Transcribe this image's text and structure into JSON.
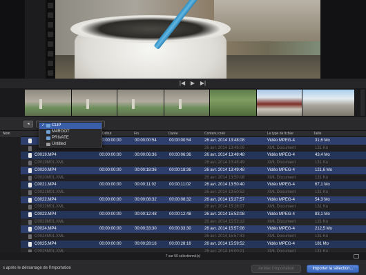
{
  "toolbar": {
    "back_glyph": "◂",
    "location_options": [
      {
        "label": "CLIP",
        "selected": true,
        "icon": "folder-icon"
      },
      {
        "label": "M4ROOT",
        "selected": false,
        "icon": "folder-icon"
      },
      {
        "label": "PRIVATE",
        "selected": false,
        "icon": "folder-icon"
      },
      {
        "label": "Untitled",
        "selected": false,
        "icon": "disk-icon"
      }
    ],
    "check_glyph": "✓"
  },
  "transport": {
    "prev": "|◀",
    "play": "▶",
    "next": "▶|"
  },
  "table": {
    "columns": [
      "Nom",
      "Début",
      "Fin",
      "Durée",
      "Contenu créé",
      "Le type de fichier",
      "Taille"
    ],
    "rows": [
      {
        "name": "",
        "start": "00:00:00:00",
        "end": "00:00:00:54",
        "duration": "00:00:00:54",
        "created": "26 avr. 2014 13:48:08",
        "type": "Vidéo MPEG-4",
        "size": "31,6 Mo",
        "kind": "mp4"
      },
      {
        "name": "",
        "start": "",
        "end": "",
        "duration": "",
        "created": "26 avr. 2014 13:48:09",
        "type": "XML Document",
        "size": "131 Ko",
        "kind": "xml"
      },
      {
        "name": "C0019.MP4",
        "start": "00:00:00:00",
        "end": "00:00:06:36",
        "duration": "00:00:06:36",
        "created": "26 avr. 2014 13:48:48",
        "type": "Vidéo MPEG-4",
        "size": "43,4 Mo",
        "kind": "mp4"
      },
      {
        "name": "C0019M01.XML",
        "start": "",
        "end": "",
        "duration": "",
        "created": "26 avr. 2014 13:48:49",
        "type": "XML Document",
        "size": "131 Ko",
        "kind": "xml"
      },
      {
        "name": "C0020.MP4",
        "start": "00:00:00:00",
        "end": "00:00:18:36",
        "duration": "00:00:18:36",
        "created": "26 avr. 2014 13:49:48",
        "type": "Vidéo MPEG-4",
        "size": "121,6 Mo",
        "kind": "mp4"
      },
      {
        "name": "C0020M01.XML",
        "start": "",
        "end": "",
        "duration": "",
        "created": "26 avr. 2014 13:50:08",
        "type": "XML Document",
        "size": "131 Ko",
        "kind": "xml"
      },
      {
        "name": "C0021.MP4",
        "start": "00:00:00:00",
        "end": "00:00:11:02",
        "duration": "00:00:11:02",
        "created": "26 avr. 2014 13:50:40",
        "type": "Vidéo MPEG-4",
        "size": "67,1 Mo",
        "kind": "mp4"
      },
      {
        "name": "C0021M01.XML",
        "start": "",
        "end": "",
        "duration": "",
        "created": "26 avr. 2014 13:50:52",
        "type": "XML Document",
        "size": "131 Ko",
        "kind": "xml"
      },
      {
        "name": "C0022.MP4",
        "start": "00:00:00:00",
        "end": "00:00:08:32",
        "duration": "00:00:08:32",
        "created": "26 avr. 2014 15:27:57",
        "type": "Vidéo MPEG-4",
        "size": "54,3 Mo",
        "kind": "mp4"
      },
      {
        "name": "C0022M01.XML",
        "start": "",
        "end": "",
        "duration": "",
        "created": "26 avr. 2014 15:28:07",
        "type": "XML Document",
        "size": "131 Ko",
        "kind": "xml"
      },
      {
        "name": "C0023.MP4",
        "start": "00:00:00:00",
        "end": "00:00:12:48",
        "duration": "00:00:12:48",
        "created": "26 avr. 2014 15:53:08",
        "type": "Vidéo MPEG-4",
        "size": "83,1 Mo",
        "kind": "mp4"
      },
      {
        "name": "C0023M01.XML",
        "start": "",
        "end": "",
        "duration": "",
        "created": "26 avr. 2014 15:53:22",
        "type": "XML Document",
        "size": "131 Ko",
        "kind": "xml"
      },
      {
        "name": "C0024.MP4",
        "start": "00:00:00:00",
        "end": "00:00:33:30",
        "duration": "00:00:33:30",
        "created": "26 avr. 2014 15:57:08",
        "type": "Vidéo MPEG-4",
        "size": "212,5 Mo",
        "kind": "mp4"
      },
      {
        "name": "C0024M01.XML",
        "start": "",
        "end": "",
        "duration": "",
        "created": "26 avr. 2014 15:57:43",
        "type": "XML Document",
        "size": "131 Ko",
        "kind": "xml"
      },
      {
        "name": "C0025.MP4",
        "start": "00:00:00:00",
        "end": "00:00:28:16",
        "duration": "00:00:28:16",
        "created": "26 avr. 2014 15:59:52",
        "type": "Vidéo MPEG-4",
        "size": "181 Mo",
        "kind": "mp4"
      },
      {
        "name": "C0025M01.XML",
        "start": "",
        "end": "",
        "duration": "",
        "created": "26 avr. 2014 16:00:21",
        "type": "XML Document",
        "size": "131 Ko",
        "kind": "xml"
      }
    ]
  },
  "status": {
    "selection_text": "7 sur 50 sélectionné(s)"
  },
  "bottom": {
    "message": "s après le démarrage de l'importation",
    "stop_label": "Arrêter l'importation",
    "import_label": "Importer la sélection..."
  },
  "colors": {
    "selection": "#2e3f6e",
    "accent": "#3563b8"
  }
}
